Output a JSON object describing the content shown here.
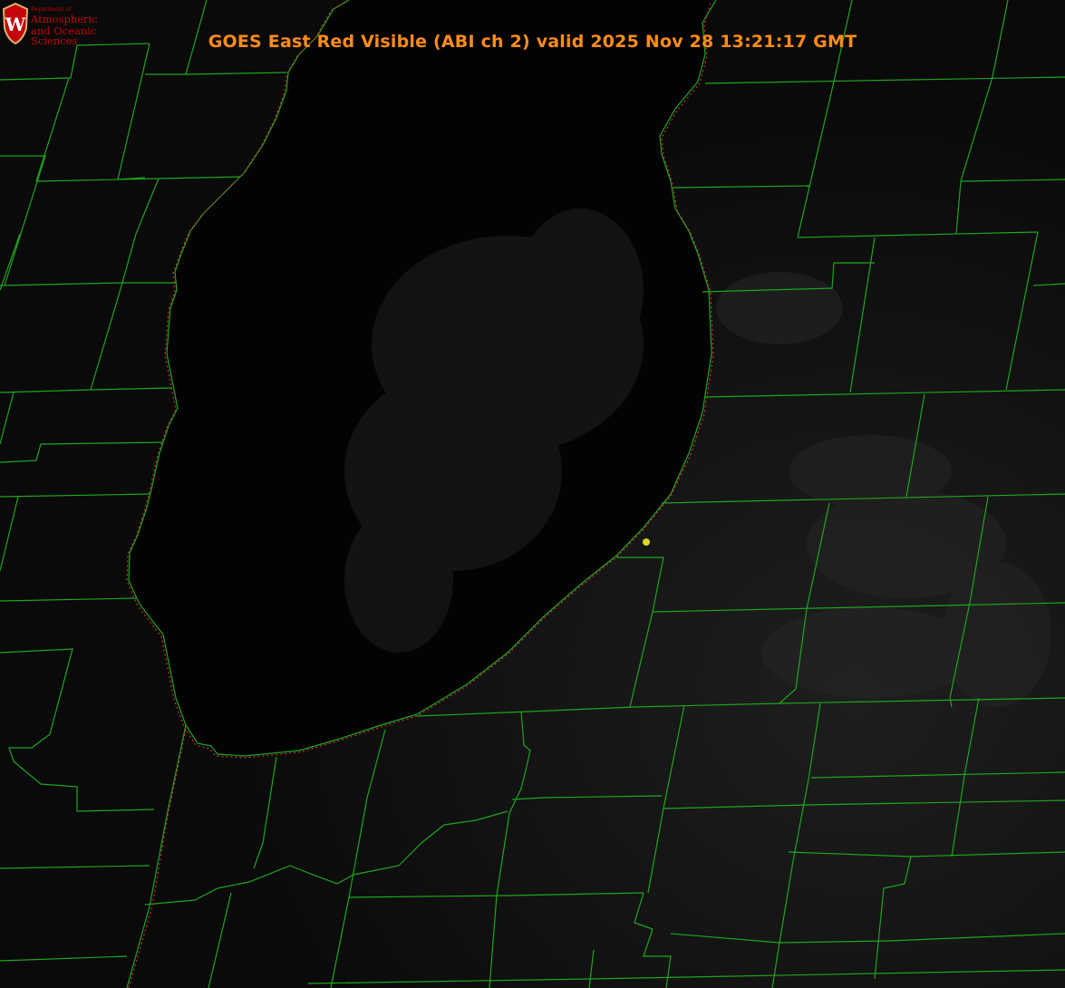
{
  "header": {
    "title": "GOES East Red Visible (ABI ch 2) valid 2025 Nov 28 13:21:17 GMT"
  },
  "logo": {
    "letter": "W",
    "dept": "Department of",
    "line1": "Atmospheric",
    "line2": "and Oceanic Sciences"
  },
  "colors": {
    "background": "#000000",
    "county_lines": "#1fa51f",
    "coastline": "#c8323a",
    "title": "#ff8c1a",
    "marker": "#d7d72a",
    "logo": "#c5050c"
  }
}
